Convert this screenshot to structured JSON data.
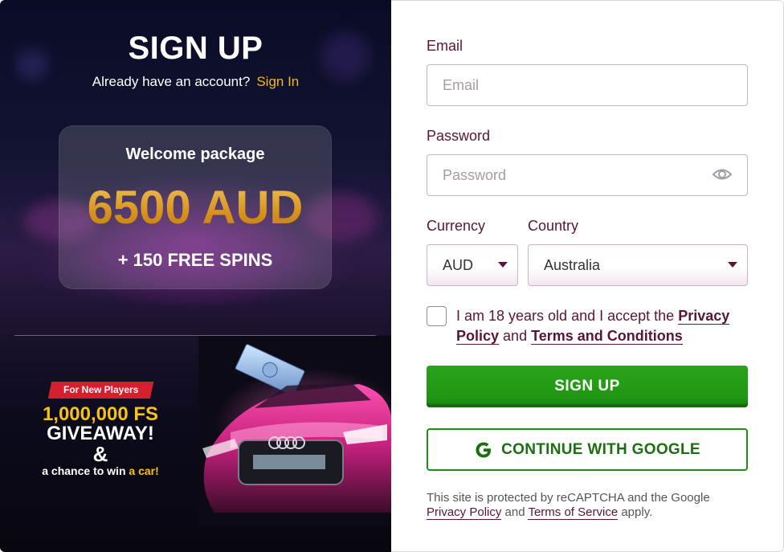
{
  "promo": {
    "title": "SIGN UP",
    "already_text": "Already have an account?",
    "signin_link": "Sign In",
    "welcome_label": "Welcome package",
    "welcome_amount": "6500 AUD",
    "welcome_spins": "+ 150 FREE SPINS",
    "tag": "For New Players",
    "giveaway_fs": "1,000,000 FS",
    "giveaway_word": "GIVEAWAY!",
    "ampersand": "&",
    "chance_text": "a chance to win",
    "chance_highlight": "a car!"
  },
  "form": {
    "email_label": "Email",
    "email_placeholder": "Email",
    "email_value": "",
    "password_label": "Password",
    "password_placeholder": "Password",
    "password_value": "",
    "currency_label": "Currency",
    "currency_value": "AUD",
    "country_label": "Country",
    "country_value": "Australia",
    "terms_prefix": "I am 18 years old and I accept the",
    "terms_privacy": "Privacy Policy",
    "terms_and": "and",
    "terms_conditions": "Terms and Conditions",
    "signup_button": "SIGN UP",
    "google_button": "CONTINUE WITH GOOGLE",
    "recaptcha_prefix": "This site is protected by reCAPTCHA and the Google",
    "recaptcha_privacy": "Privacy Policy",
    "recaptcha_and": "and",
    "recaptcha_terms": "Terms of Service",
    "recaptcha_suffix": "apply."
  },
  "colors": {
    "accent_gold": "#f2b820",
    "label_maroon": "#5a1536",
    "button_green": "#1f9512",
    "promo_red": "#d4202c"
  },
  "icons": {
    "eye": "eye-icon",
    "google": "google-icon",
    "caret": "chevron-down-icon"
  }
}
